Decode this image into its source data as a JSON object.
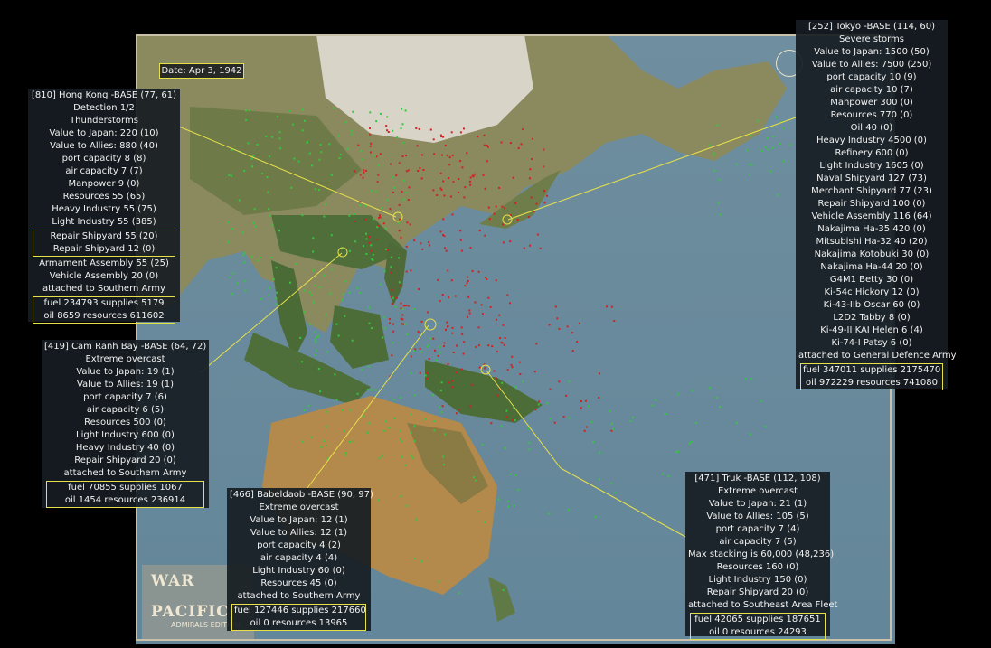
{
  "date_label": "Date: Apr 3, 1942",
  "logo": {
    "line1": "WAR",
    "line2": "PACIFIC",
    "line3": "ADMIRALS EDITION"
  },
  "colors": {
    "panel_bg": "#161c22",
    "highlight": "#e6e04a",
    "japan_units": "#d42020",
    "allied_units": "#32c83c"
  },
  "bases": {
    "hongkong": {
      "title": "[810] Hong Kong -BASE (77, 61)",
      "lines": [
        "Detection 1/2",
        "Thunderstorms",
        "Value to Japan: 220 (10)",
        "Value to Allies: 880 (40)",
        "port capacity 8 (8)",
        "air capacity 7 (7)",
        "Manpower 9 (0)",
        "Resources 55 (65)",
        "Heavy Industry 55 (75)",
        "Light Industry 55 (385)"
      ],
      "boxed1": [
        "Repair Shipyard 55 (20)",
        "Repair Shipyard 12 (0)"
      ],
      "lines2": [
        "Armament Assembly 55 (25)",
        "Vehicle Assembly 20 (0)",
        "attached to Southern Army"
      ],
      "boxed2": [
        "fuel 234793 supplies 5179",
        "oil 8659 resources 611602"
      ]
    },
    "camranh": {
      "title": "[419] Cam Ranh Bay -BASE (64, 72)",
      "lines": [
        "Extreme overcast",
        "Value to Japan: 19 (1)",
        "Value to Allies: 19 (1)",
        "port capacity 7 (6)",
        "air capacity 6 (5)",
        "Resources 500 (0)",
        "Light Industry 600 (0)",
        "Heavy Industry 40 (0)",
        "Repair Shipyard 20 (0)",
        "attached to Southern Army"
      ],
      "boxed": [
        "fuel 70855 supplies 1067",
        "oil 1454 resources 236914"
      ]
    },
    "babeldaob": {
      "title": "[466] Babeldaob -BASE (90, 97)",
      "lines": [
        "Extreme overcast",
        "Value to Japan: 12 (1)",
        "Value to Allies: 12 (1)",
        "port capacity 4 (2)",
        "air capacity 4 (4)",
        "Light Industry 60 (0)",
        "Resources 45 (0)",
        "attached to Southern Army"
      ],
      "boxed": [
        "fuel 127446 supplies 217660",
        "oil 0 resources 13965"
      ]
    },
    "truk": {
      "title": "[471] Truk -BASE (112, 108)",
      "lines": [
        "Extreme overcast",
        "Value to Japan: 21 (1)",
        "Value to Allies: 105 (5)",
        "port capacity 7 (4)",
        "air capacity 7 (5)",
        "Max stacking is 60,000 (48,236)",
        "Resources 160 (0)",
        "Light Industry 150 (0)",
        "Repair Shipyard 20 (0)",
        "attached to Southeast Area Fleet"
      ],
      "boxed": [
        "fuel 42065 supplies 187651",
        "oil 0 resources 24293"
      ]
    },
    "tokyo": {
      "title": "[252] Tokyo -BASE (114, 60)",
      "lines": [
        "Severe storms",
        "Value to Japan: 1500 (50)",
        "Value to Allies: 7500 (250)",
        "port capacity 10 (9)",
        "air capacity 10 (7)",
        "Manpower 300 (0)",
        "Resources 770 (0)",
        "Oil 40 (0)",
        "Heavy Industry 4500 (0)",
        "Refinery 600 (0)",
        "Light Industry 1605 (0)",
        "Naval Shipyard 127 (73)",
        "Merchant Shipyard 77 (23)",
        "Repair Shipyard 100 (0)",
        "Vehicle Assembly 116 (64)",
        "Nakajima Ha-35 420 (0)",
        "Mitsubishi Ha-32 40 (20)",
        "Nakajima Kotobuki 30 (0)",
        "Nakajima Ha-44 20 (0)",
        "G4M1 Betty 30 (0)",
        "Ki-54c Hickory 12 (0)",
        "Ki-43-IIb Oscar 60 (0)",
        "L2D2 Tabby 8 (0)",
        "Ki-49-II KAI Helen 6 (4)",
        "Ki-74-I Patsy 6 (0)",
        "attached to General Defence Army"
      ],
      "boxed": [
        "fuel 347011 supplies 2175470",
        "oil 972229 resources 741080"
      ]
    }
  }
}
